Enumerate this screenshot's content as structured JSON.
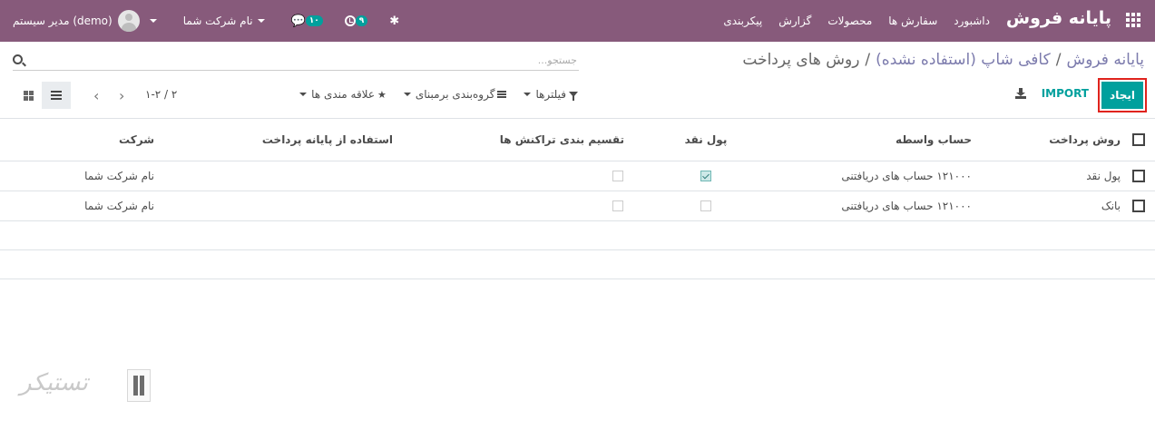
{
  "navbar": {
    "brand": "پایانه فروش",
    "menu": [
      "داشبورد",
      "سفارش ها",
      "محصولات",
      "گزارش",
      "پیکربندی"
    ],
    "messages_badge": "۱۰",
    "activity_badge": "۹",
    "company": "نام شرکت شما",
    "user": "مدیر سیستم (demo)",
    "color": "#875a7b"
  },
  "breadcrumb": {
    "root": "پایانه فروش",
    "parent": "کافی شاپ (استفاده نشده)",
    "current": "روش های پرداخت",
    "separator": "/"
  },
  "search": {
    "placeholder": "جستجو...",
    "value": ""
  },
  "toolbar": {
    "create_label": "ایجاد",
    "import_label": "IMPORT",
    "accent": "#00a09d"
  },
  "filters": {
    "filters_label": "فیلترها",
    "groupby_label": "گروه‌بندی برمبنای",
    "favorites_label": "علاقه مندی ها"
  },
  "pager": {
    "value": "۱-۲ / ۲",
    "text": "۱-۲ / ۲"
  },
  "table": {
    "columns": {
      "name": "روش پرداخت",
      "account": "حساب واسطه",
      "cash": "پول نقد",
      "split": "تقسیم بندی تراکنش ها",
      "pos": "استفاده از پایانه پرداخت",
      "company": "شرکت"
    },
    "rows": [
      {
        "name": "پول نقد",
        "account": "۱۲۱۰۰۰ حساب های دریافتنی",
        "cash": true,
        "split": false,
        "pos": "",
        "company": "نام شرکت شما"
      },
      {
        "name": "بانک",
        "account": "۱۲۱۰۰۰ حساب های دریافتنی",
        "cash": false,
        "split": false,
        "pos": "",
        "company": "نام شرکت شما"
      }
    ]
  },
  "watermark": {
    "text": "تستیکر"
  }
}
